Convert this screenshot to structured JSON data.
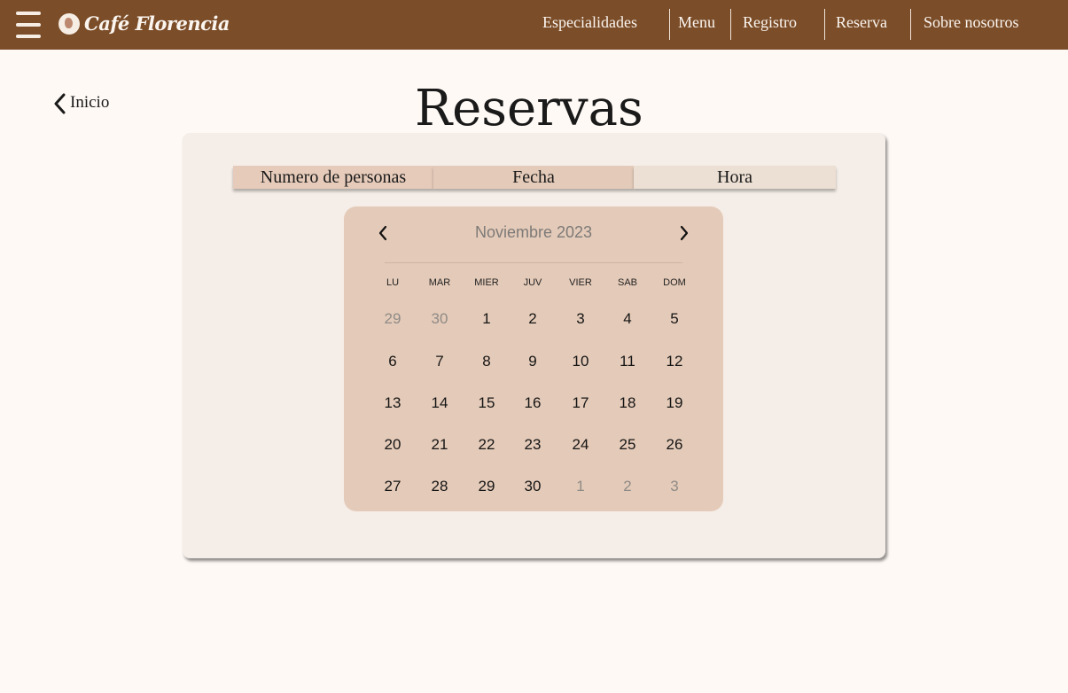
{
  "header": {
    "brand": "Café Florencia",
    "nav": [
      "Especialidades",
      "Menu",
      "Registro",
      "Reserva",
      "Sobre nosotros"
    ]
  },
  "back": {
    "label": "Inicio"
  },
  "page": {
    "title": "Reservas"
  },
  "tabs": [
    "Numero de personas",
    "Fecha",
    "Hora"
  ],
  "calendar": {
    "month": "Noviembre 2023",
    "weekdays": [
      "LU",
      "MAR",
      "MIER",
      "JUV",
      "VIER",
      "SAB",
      "DOM"
    ],
    "weeks": [
      [
        {
          "d": "29",
          "m": true
        },
        {
          "d": "30",
          "m": true
        },
        {
          "d": "1"
        },
        {
          "d": "2"
        },
        {
          "d": "3"
        },
        {
          "d": "4"
        },
        {
          "d": "5"
        }
      ],
      [
        {
          "d": "6"
        },
        {
          "d": "7"
        },
        {
          "d": "8"
        },
        {
          "d": "9"
        },
        {
          "d": "10"
        },
        {
          "d": "11"
        },
        {
          "d": "12"
        }
      ],
      [
        {
          "d": "13"
        },
        {
          "d": "14"
        },
        {
          "d": "15"
        },
        {
          "d": "16"
        },
        {
          "d": "17"
        },
        {
          "d": "18"
        },
        {
          "d": "19"
        }
      ],
      [
        {
          "d": "20"
        },
        {
          "d": "21"
        },
        {
          "d": "22"
        },
        {
          "d": "23"
        },
        {
          "d": "24"
        },
        {
          "d": "25"
        },
        {
          "d": "26"
        }
      ],
      [
        {
          "d": "27"
        },
        {
          "d": "28"
        },
        {
          "d": "29"
        },
        {
          "d": "30"
        },
        {
          "d": "1",
          "m": true
        },
        {
          "d": "2",
          "m": true
        },
        {
          "d": "3",
          "m": true
        }
      ]
    ]
  },
  "colors": {
    "header": "#7b4d29",
    "background": "#fef9f5",
    "panel": "#f5ede7",
    "calendar": "#e4cab8",
    "tab_active": "#e6cbba",
    "tab_inactive": "#ecdfd3"
  },
  "icons": {
    "menu": "hamburger-icon",
    "logo": "coffee-logo-icon",
    "back": "chevron-left-icon",
    "prev_month": "chevron-left-icon",
    "next_month": "chevron-right-icon"
  }
}
